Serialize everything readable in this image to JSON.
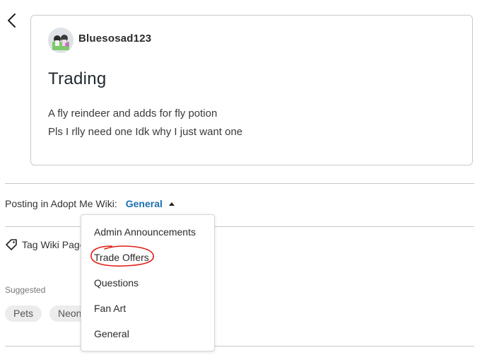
{
  "post": {
    "username": "Bluesosad123",
    "title": "Trading",
    "body_lines": [
      "A fly reindeer and adds for fly potion",
      "Pls I rlly need one Idk why I just want one"
    ]
  },
  "posting": {
    "label": "Posting in Adopt Me Wiki:",
    "selected_category": "General"
  },
  "dropdown": {
    "items": [
      "Admin Announcements",
      "Trade Offers",
      "Questions",
      "Fan Art",
      "General"
    ]
  },
  "tag": {
    "label": "Tag Wiki Page"
  },
  "suggested": {
    "label": "Suggested",
    "chips": [
      "Pets",
      "Neon"
    ]
  },
  "colors": {
    "link": "#1a6fb0",
    "annotation": "#e0201a"
  },
  "icons": {
    "back": "chevron-left-icon",
    "tag": "tag-icon",
    "caret": "caret-up-icon"
  }
}
